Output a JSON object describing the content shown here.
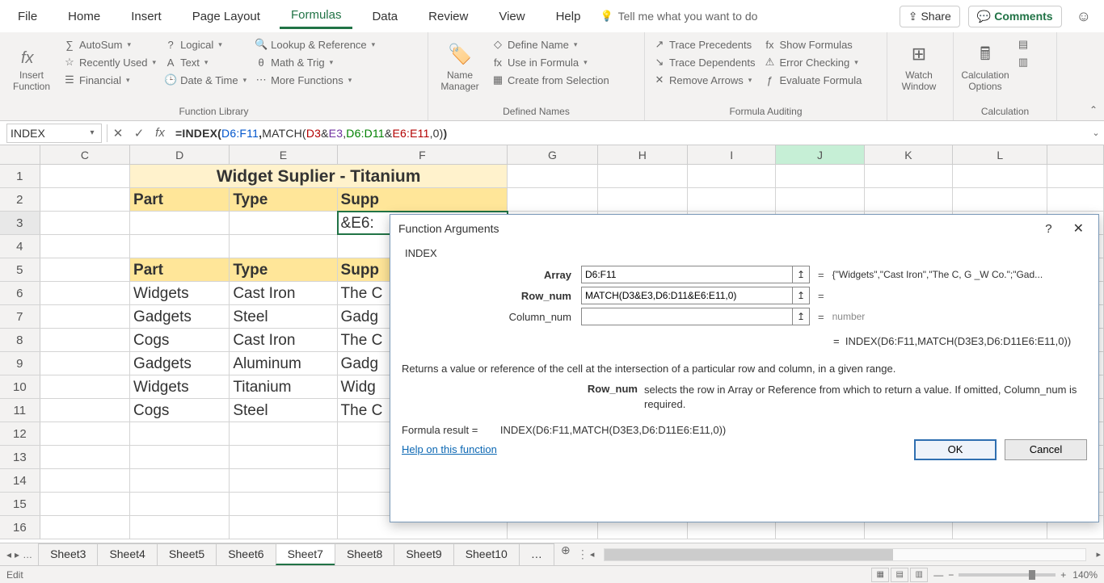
{
  "menu": {
    "items": [
      "File",
      "Home",
      "Insert",
      "Page Layout",
      "Formulas",
      "Data",
      "Review",
      "View",
      "Help"
    ],
    "active": "Formulas",
    "tell_me": "Tell me what you want to do",
    "share": "Share",
    "comments": "Comments"
  },
  "ribbon": {
    "insert_function": "Insert Function",
    "function_library": {
      "title": "Function Library",
      "col1": [
        "AutoSum",
        "Recently Used",
        "Financial"
      ],
      "col2": [
        "Logical",
        "Text",
        "Date & Time"
      ],
      "col3": [
        "Lookup & Reference",
        "Math & Trig",
        "More Functions"
      ]
    },
    "defined_names": {
      "title": "Defined Names",
      "name_manager": "Name Manager",
      "items": [
        "Define Name",
        "Use in Formula",
        "Create from Selection"
      ]
    },
    "formula_auditing": {
      "title": "Formula Auditing",
      "col1": [
        "Trace Precedents",
        "Trace Dependents",
        "Remove Arrows"
      ],
      "col2": [
        "Show Formulas",
        "Error Checking",
        "Evaluate Formula"
      ]
    },
    "watch_window": "Watch Window",
    "calculation": {
      "title": "Calculation",
      "options": "Calculation Options"
    }
  },
  "namebox": "INDEX",
  "formula_bar": {
    "prefix": "=INDEX(",
    "arr": "D6:F11",
    "comma1": ",",
    "match": "MATCH(",
    "m1": "D3",
    "amp1": "&",
    "m2": "E3",
    "comma2": ",",
    "m3": "D6:D11",
    "amp2": "&",
    "m4": "E6:E11",
    "comma3": ",",
    "m5": "0",
    "matchclose": ")",
    "close": ")"
  },
  "columns": [
    "C",
    "D",
    "E",
    "F",
    "G",
    "H",
    "I",
    "J",
    "K",
    "L",
    ""
  ],
  "sheet": {
    "title": "Widget Suplier - Titanium",
    "headers": [
      "Part",
      "Type",
      "Supp"
    ],
    "f3": "&E6:",
    "table": [
      {
        "part": "Widgets",
        "type": "Cast Iron",
        "supp": "The C"
      },
      {
        "part": "Gadgets",
        "type": "Steel",
        "supp": "Gadg"
      },
      {
        "part": "Cogs",
        "type": "Cast Iron",
        "supp": "The C"
      },
      {
        "part": "Gadgets",
        "type": "Aluminum",
        "supp": "Gadg"
      },
      {
        "part": "Widgets",
        "type": "Titanium",
        "supp": "Widg"
      },
      {
        "part": "Cogs",
        "type": "Steel",
        "supp": "The C"
      }
    ]
  },
  "dialog": {
    "title": "Function Arguments",
    "fname": "INDEX",
    "args": [
      {
        "label": "Array",
        "bold": true,
        "value": "D6:F11",
        "result": "{\"Widgets\",\"Cast Iron\",\"The C, G _W Co.\";\"Gad..."
      },
      {
        "label": "Row_num",
        "bold": true,
        "value": "MATCH(D3&E3,D6:D11&E6:E11,0)",
        "result": ""
      },
      {
        "label": "Column_num",
        "bold": false,
        "value": "",
        "result": "number"
      }
    ],
    "overall": "INDEX(D6:F11,MATCH(D3E3,D6:D11E6:E11,0))",
    "desc": "Returns a value or reference of the cell at the intersection of a particular row and column, in a given range.",
    "arg_desc_key": "Row_num",
    "arg_desc_val": "selects the row in Array or Reference from which to return a value. If omitted, Column_num is required.",
    "formula_result_label": "Formula result =",
    "formula_result": "INDEX(D6:F11,MATCH(D3E3,D6:D11E6:E11,0))",
    "help_link": "Help on this function",
    "ok": "OK",
    "cancel": "Cancel"
  },
  "tabs": {
    "list": [
      "Sheet3",
      "Sheet4",
      "Sheet5",
      "Sheet6",
      "Sheet7",
      "Sheet8",
      "Sheet9",
      "Sheet10"
    ],
    "active": "Sheet7"
  },
  "status": {
    "mode": "Edit",
    "zoom": "140%"
  }
}
